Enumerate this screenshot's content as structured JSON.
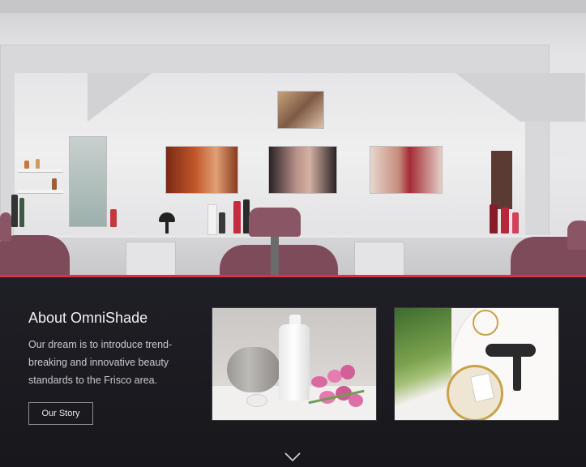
{
  "hero": {
    "image": "salon-interior-mirror-chairs"
  },
  "about": {
    "title": "About OmniShade",
    "description": "Our dream is to introduce trend-breaking and innovative beauty standards to the Frisco area.",
    "button_label": "Our Story"
  },
  "gallery": {
    "items": [
      {
        "image": "spa-towel-soap-pink-tulips-candle"
      },
      {
        "image": "hair-dryer-tray-palm-leaves"
      }
    ]
  },
  "scroll_indicator": {
    "icon": "chevron-down-icon"
  },
  "colors": {
    "accent": "#d8334a",
    "band_background": "#1d1d23",
    "text_primary": "#f2f2f4",
    "text_secondary": "#c9c9cf"
  }
}
